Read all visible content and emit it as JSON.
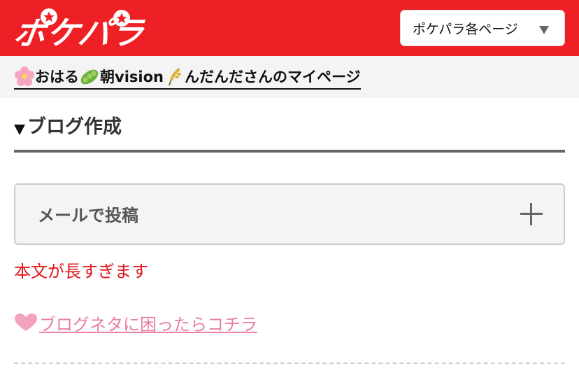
{
  "header": {
    "logo_text": "ポケパラ",
    "page_menu_label": "ポケパラ各ページ",
    "brand_color": "#ee1f25"
  },
  "user_bar": {
    "prefix_emoji": "cherry-blossom-icon",
    "part1": "おはる",
    "mid_emoji": "edamame-icon",
    "part2": "朝vision",
    "suffix_emoji": "rice-icon",
    "part3": "んだんださんのマイページ"
  },
  "section": {
    "title": "ブログ作成"
  },
  "mail_post": {
    "label": "メールで投稿",
    "icon": "plus-icon"
  },
  "error": {
    "message": "本文が長すぎます",
    "color": "#e1141a"
  },
  "tips": {
    "icon": "heart-icon",
    "link_text": "ブログネタに困ったらコチラ",
    "link_color": "#e97f9d"
  }
}
